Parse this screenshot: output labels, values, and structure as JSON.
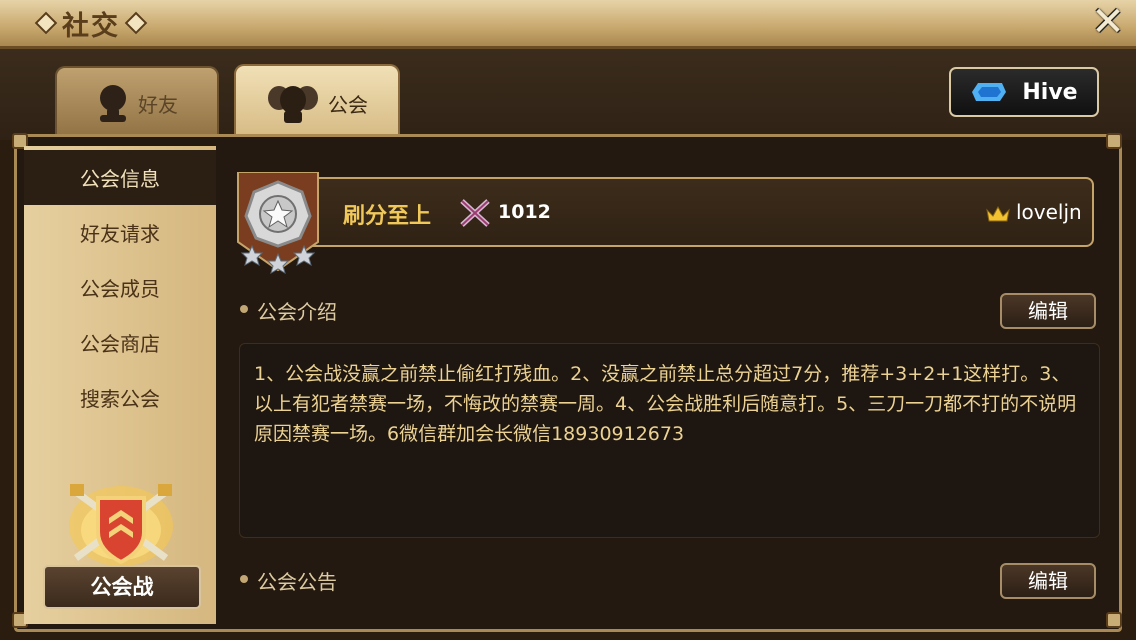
{
  "window": {
    "title": "社交",
    "close_glyph": "✕"
  },
  "tabs": [
    {
      "label": "好友",
      "icon": "friend-head-icon",
      "active": false
    },
    {
      "label": "公会",
      "icon": "guild-heads-icon",
      "active": true
    }
  ],
  "hive": {
    "label": "Hive",
    "icon": "hive-logo-icon"
  },
  "sidebar": {
    "items": [
      {
        "label": "公会信息",
        "active": true
      },
      {
        "label": "好友请求",
        "active": false
      },
      {
        "label": "公会成员",
        "active": false
      },
      {
        "label": "公会商店",
        "active": false
      },
      {
        "label": "搜索公会",
        "active": false
      }
    ],
    "guild_war": {
      "label": "公会战",
      "icon": "guild-war-emblem-icon"
    }
  },
  "guild": {
    "name": "刷分至上",
    "score": "1012",
    "score_icon": "crossed-swords-icon",
    "leader": "loveljn",
    "leader_icon": "crown-icon",
    "rank_icon": "silver-star-badge-icon",
    "stars": 3
  },
  "intro": {
    "label": "公会介绍",
    "edit_label": "编辑",
    "text": "1、公会战没赢之前禁止偷红打残血。2、没赢之前禁止总分超过7分，推荐+3+2+1这样打。3、以上有犯者禁赛一场，不悔改的禁赛一周。4、公会战胜利后随意打。5、三刀一刀都不打的不说明原因禁赛一场。6微信群加会长微信18930912673"
  },
  "notice": {
    "label": "公会公告",
    "edit_label": "编辑"
  },
  "colors": {
    "accent_gold": "#f0c85a",
    "panel_dark": "#241910",
    "sidebar_tan": "#e6cf9f"
  }
}
